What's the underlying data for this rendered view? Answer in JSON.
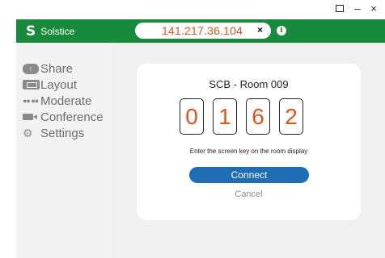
{
  "window_controls": {
    "maximize_label": "",
    "minimize_label": "–",
    "close_label": "×"
  },
  "header": {
    "logo_mark": "S",
    "app_name": "Solstice",
    "address_value": "141.217.36.104",
    "clear_label": "×",
    "info_label": "i",
    "colors": {
      "brand_green": "#178a3b",
      "accent_orange": "#e0541c"
    }
  },
  "sidebar": {
    "items": [
      {
        "label": "Share",
        "icon": "share-icon"
      },
      {
        "label": "Layout",
        "icon": "layout-icon"
      },
      {
        "label": "Moderate",
        "icon": "moderate-icon"
      },
      {
        "label": "Conference",
        "icon": "conference-icon"
      },
      {
        "label": "Settings",
        "icon": "gear-icon"
      }
    ]
  },
  "dialog": {
    "room_name": "SCB - Room 009",
    "key_digits": [
      "0",
      "1",
      "6",
      "2"
    ],
    "hint": "Enter the screen key on the room display",
    "connect_label": "Connect",
    "cancel_label": "Cancel",
    "colors": {
      "connect_button": "#1f6db5"
    }
  }
}
